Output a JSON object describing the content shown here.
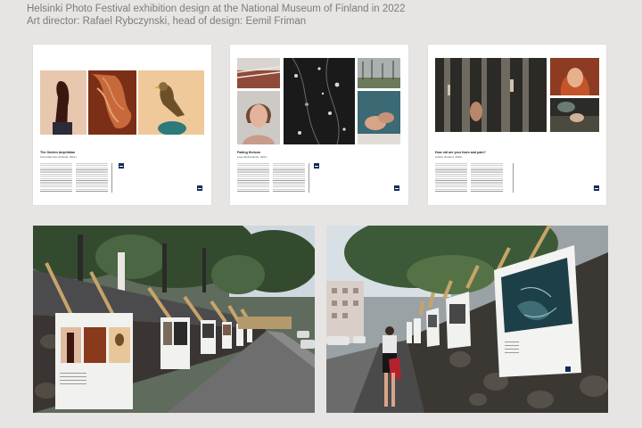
{
  "caption": {
    "line1": "Helsinki Photo Festival exhibition design at the National Museum of Finland in 2022",
    "line2": "Art director: Rafael Rybczynski, head of design: Eemil Friman"
  },
  "colors": {
    "background": "#e6e5e3",
    "caption_text": "#7b7b7b",
    "panel": "#ffffff",
    "logo": "#0d2e5c"
  },
  "panels": [
    {
      "title": "The Golden Amphibian",
      "subtitle": "Terhi Mannisto (Finland, 2021)"
    },
    {
      "title": "Fading Horizon",
      "subtitle": "Liisa (Netherlands, 2021)"
    },
    {
      "title": "How old are your fears and pain?",
      "subtitle": "Artistic (Finland, 2020)"
    }
  ],
  "photos": [
    {
      "scene": "outdoor-exhibition-street"
    },
    {
      "scene": "outdoor-exhibition-visitor"
    }
  ]
}
